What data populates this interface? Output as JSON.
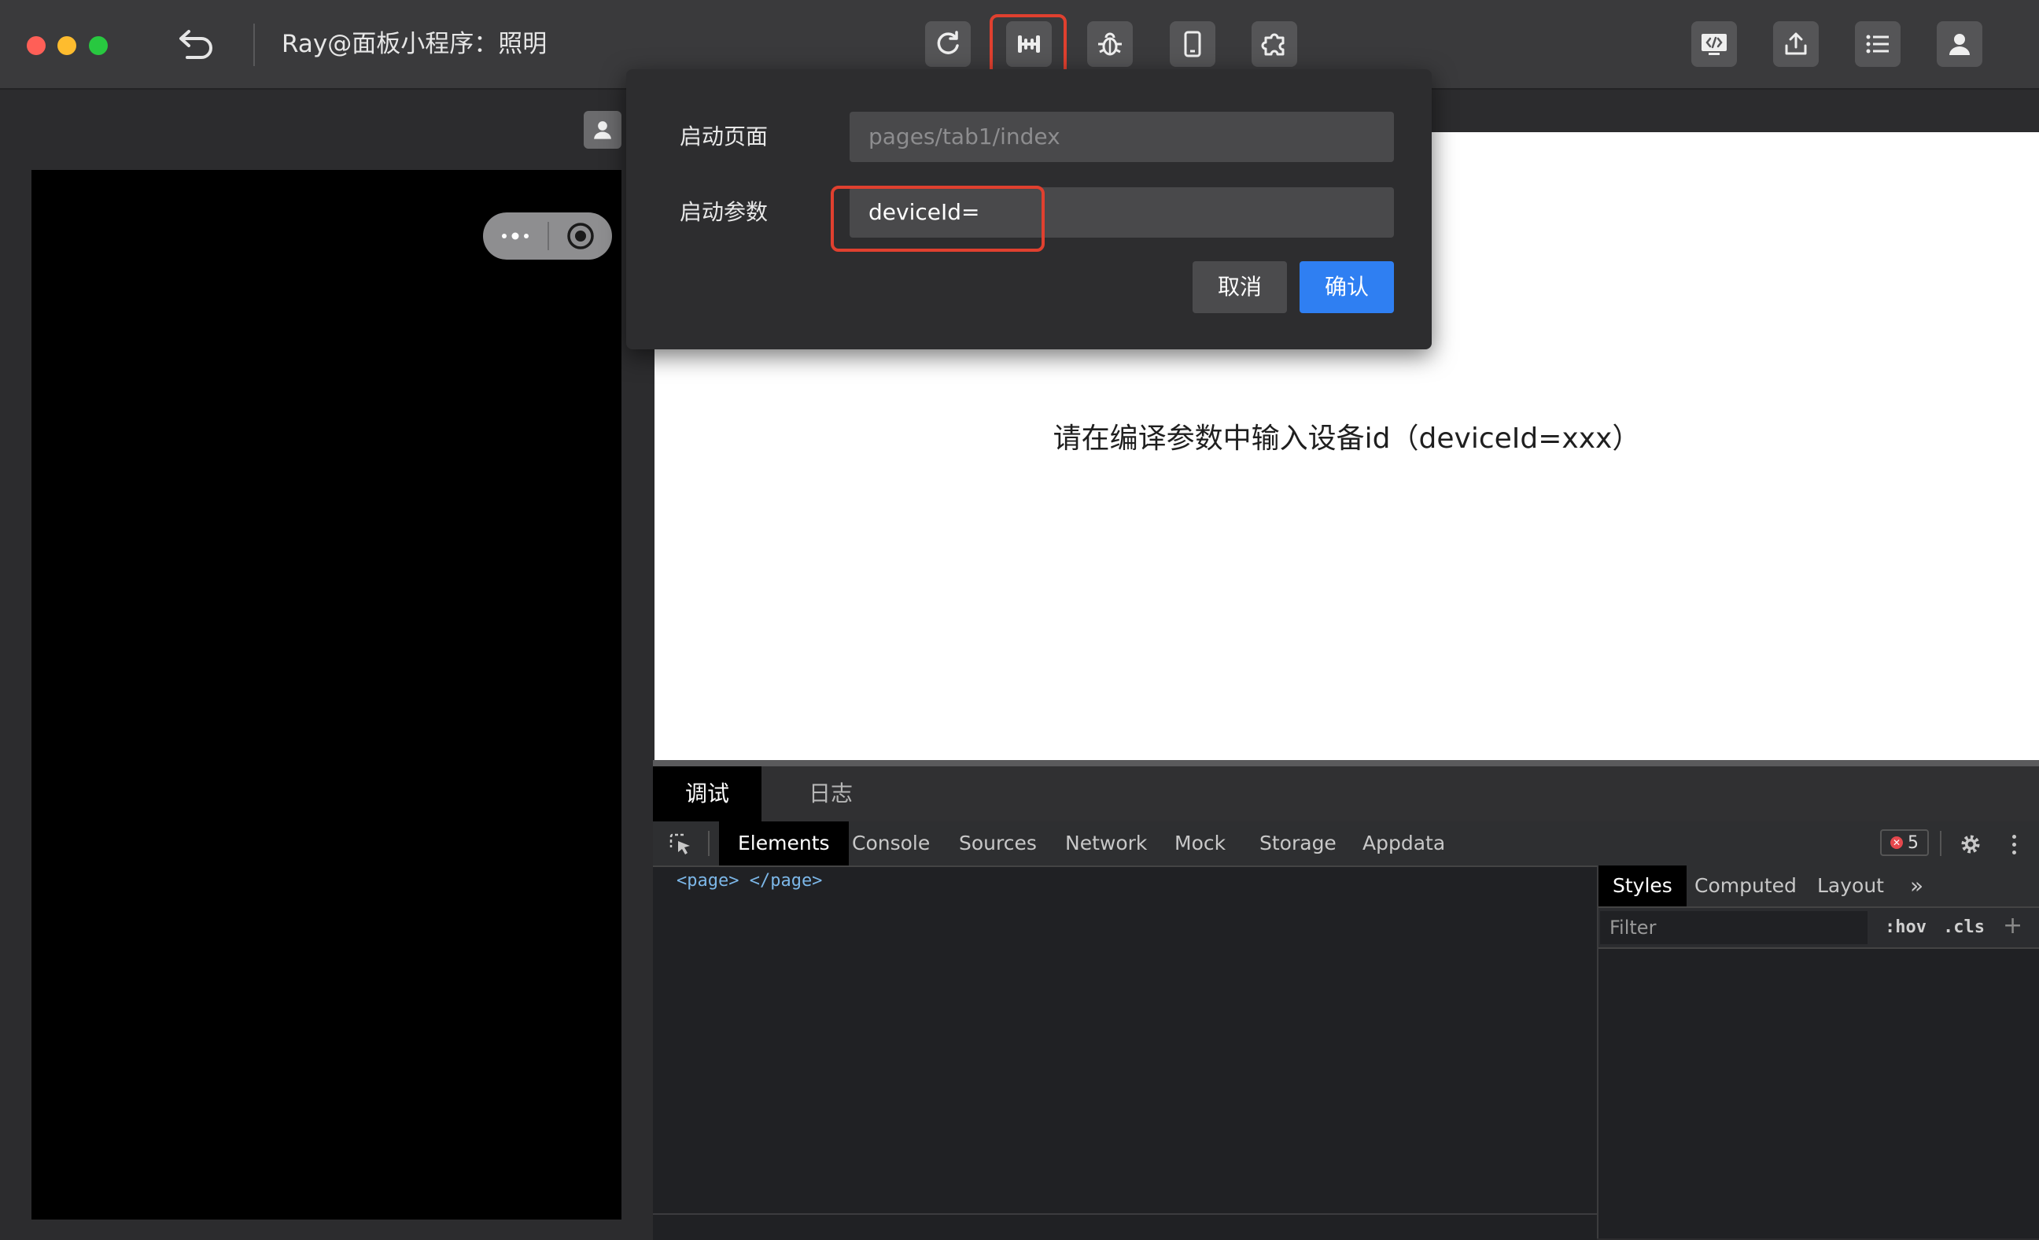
{
  "window": {
    "title": "Ray@面板小程序：照明"
  },
  "toolbar": {
    "center_icons": [
      "refresh-icon",
      "compile-settings-icon",
      "debug-icon",
      "device-icon",
      "plugin-icon"
    ],
    "right_icons": [
      "code-preview-icon",
      "upload-icon",
      "list-icon",
      "user-icon"
    ],
    "highlight_color": "#e0402f"
  },
  "dialog": {
    "start_page_label": "启动页面",
    "start_page_placeholder": "pages/tab1/index",
    "start_params_label": "启动参数",
    "start_params_value": "deviceId=",
    "cancel_label": "取消",
    "confirm_label": "确认",
    "confirm_color": "#2f7ff2"
  },
  "preview": {
    "message": "请在编译参数中输入设备id（deviceId=xxx）"
  },
  "debug_panel": {
    "tabs": [
      {
        "label": "调试",
        "active": true
      },
      {
        "label": "日志",
        "active": false
      }
    ]
  },
  "devtools": {
    "tabs": [
      "Elements",
      "Console",
      "Sources",
      "Network",
      "Mock",
      "Storage",
      "Appdata"
    ],
    "active_tab": "Elements",
    "error_count": "5",
    "dom_line": "<page> </page>",
    "styles_tabs": [
      "Styles",
      "Computed",
      "Layout"
    ],
    "styles_more": "»",
    "filter_placeholder": "Filter",
    "filter_hov": ":hov",
    "filter_cls": ".cls",
    "filter_add": "+"
  }
}
